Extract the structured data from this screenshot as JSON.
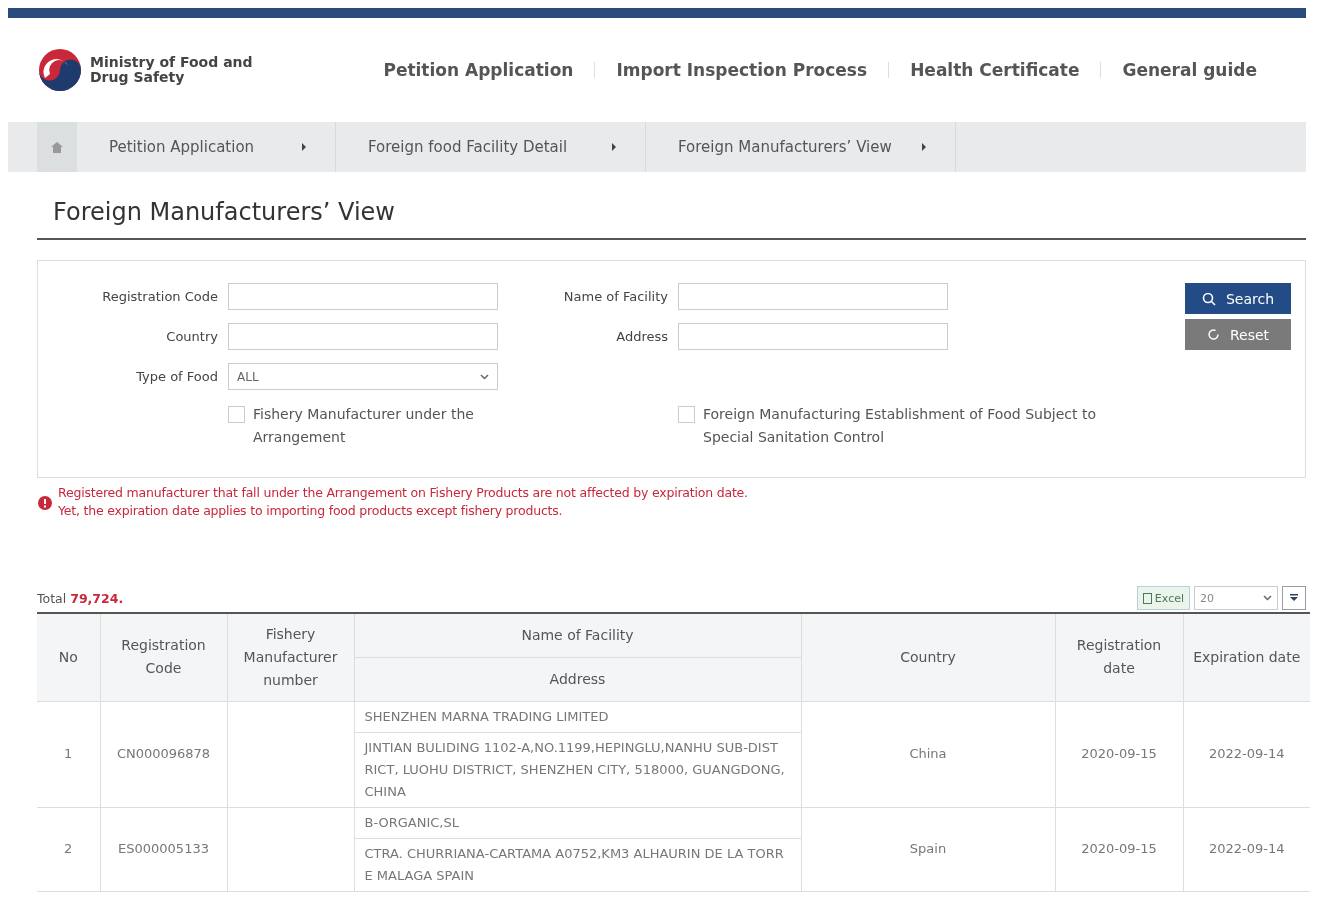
{
  "logo": {
    "text": "Ministry of Food and Drug Safety"
  },
  "nav": [
    "Petition Application",
    "Import Inspection Process",
    "Health Certificate",
    "General guide"
  ],
  "breadcrumb": [
    "Petition Application",
    "Foreign food Facility Detail",
    "Foreign Manufacturers’ View"
  ],
  "page_title": "Foreign Manufacturers’ View",
  "search_form": {
    "fields": [
      {
        "kind": "text",
        "label": "Registration Code"
      },
      {
        "kind": "text",
        "label": "Name of Facility"
      },
      {
        "kind": "text",
        "label": "Country"
      },
      {
        "kind": "text",
        "label": "Address"
      },
      {
        "kind": "select",
        "label": "Type of Food",
        "value": "ALL"
      }
    ],
    "checkboxes": [
      {
        "label": "Fishery Manufacturer under the Arrangement",
        "checked": false
      },
      {
        "label": "Foreign Manufacturing Establishment of Food Subject to Special Sanitation Control",
        "checked": false
      }
    ],
    "buttons": [
      {
        "kind": "primary",
        "label": "Search"
      },
      {
        "kind": "secondary",
        "label": "Reset"
      }
    ]
  },
  "notice": [
    "Registered manufacturer that fall under the Arrangement on Fishery Products are not affected by expiration date.",
    "Yet, the expiration date applies to importing food products except fishery products."
  ],
  "total": {
    "label": "Total",
    "value": "79,724."
  },
  "toolbar": {
    "excel": "Excel",
    "page_size": "20"
  },
  "table": {
    "columns": [
      "No",
      "Registration Code",
      "Fishery Manufacturer number",
      "Name of Facility",
      "Address",
      "Country",
      "Registration date",
      "Expiration date"
    ],
    "rows": [
      {
        "no": "1",
        "code": "CN000096878",
        "fishery": "",
        "name": "SHENZHEN MARNA TRADING LIMITED",
        "address": "JINTIAN BULIDING 1102-A,NO.1199,HEPINGLU,NANHU SUB-DISTRICT, LUOHU DISTRICT, SHENZHEN CITY, 518000, GUANGDONG, CHINA",
        "country": "China",
        "reg_date": "2020-09-15",
        "exp_date": "2022-09-14"
      },
      {
        "no": "2",
        "code": "ES000005133",
        "fishery": "",
        "name": "B-ORGANIC,SL",
        "address": "CTRA. CHURRIANA-CARTAMA A0752,KM3 ALHAURIN DE LA TORRE MALAGA SPAIN",
        "country": "Spain",
        "reg_date": "2020-09-15",
        "exp_date": "2022-09-14"
      }
    ]
  }
}
